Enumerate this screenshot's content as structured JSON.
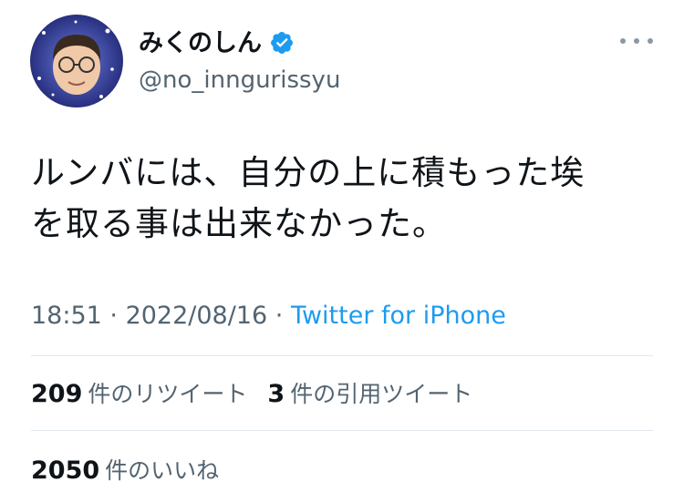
{
  "author": {
    "display_name": "みくのしん",
    "handle": "@no_inngurissyu"
  },
  "tweet": {
    "text_lines": [
      "ルンバには、自分の上に積もった埃",
      "を取る事は出来なかった。"
    ],
    "time": "18:51",
    "separator": " · ",
    "date": "2022/08/16",
    "source": "Twitter for iPhone"
  },
  "stats": {
    "retweets": {
      "count": "209",
      "label": "件のリツイート"
    },
    "quotes": {
      "count": "3",
      "label": "件の引用ツイート"
    },
    "likes": {
      "count": "2050",
      "label": "件のいいね"
    }
  },
  "colors": {
    "link": "#1d9bf0",
    "verified": "#1d9bf0",
    "secondary_text": "#536471",
    "divider": "#e1e8ed"
  },
  "icons": {
    "verified": "verified-badge-icon",
    "more": "more-options-icon"
  }
}
